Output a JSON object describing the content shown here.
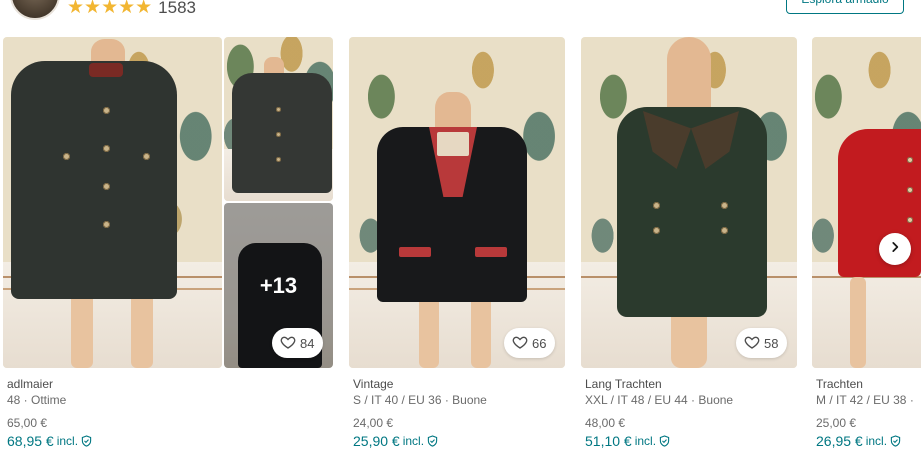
{
  "seller": {
    "rating_stars": "★★★★★",
    "rating_count": "1583",
    "explore_label": "Esplora armadio"
  },
  "listings": [
    {
      "brand": "adlmaier",
      "details": "48 · Ottime",
      "price": "65,00 €",
      "price_incl": "68,95 €",
      "incl_label": "incl.",
      "favorites": "84",
      "more_photos": "+13"
    },
    {
      "brand": "Vintage",
      "details": "S / IT 40 / EU 36 · Buone",
      "price": "24,00 €",
      "price_incl": "25,90 €",
      "incl_label": "incl.",
      "favorites": "66"
    },
    {
      "brand": "Lang Trachten",
      "details": "XXL / IT 48 / EU 44 · Buone",
      "price": "48,00 €",
      "price_incl": "51,10 €",
      "incl_label": "incl.",
      "favorites": "58"
    },
    {
      "brand": "Trachten",
      "details": "M / IT 42 / EU 38 · ",
      "price": "25,00 €",
      "price_incl": "26,95 €",
      "incl_label": "incl."
    }
  ],
  "colors": {
    "accent": "#007782",
    "star": "#f2b632"
  },
  "icons": {
    "favorite": "heart-icon",
    "next": "chevron-right-icon",
    "protection": "shield-check-icon"
  }
}
